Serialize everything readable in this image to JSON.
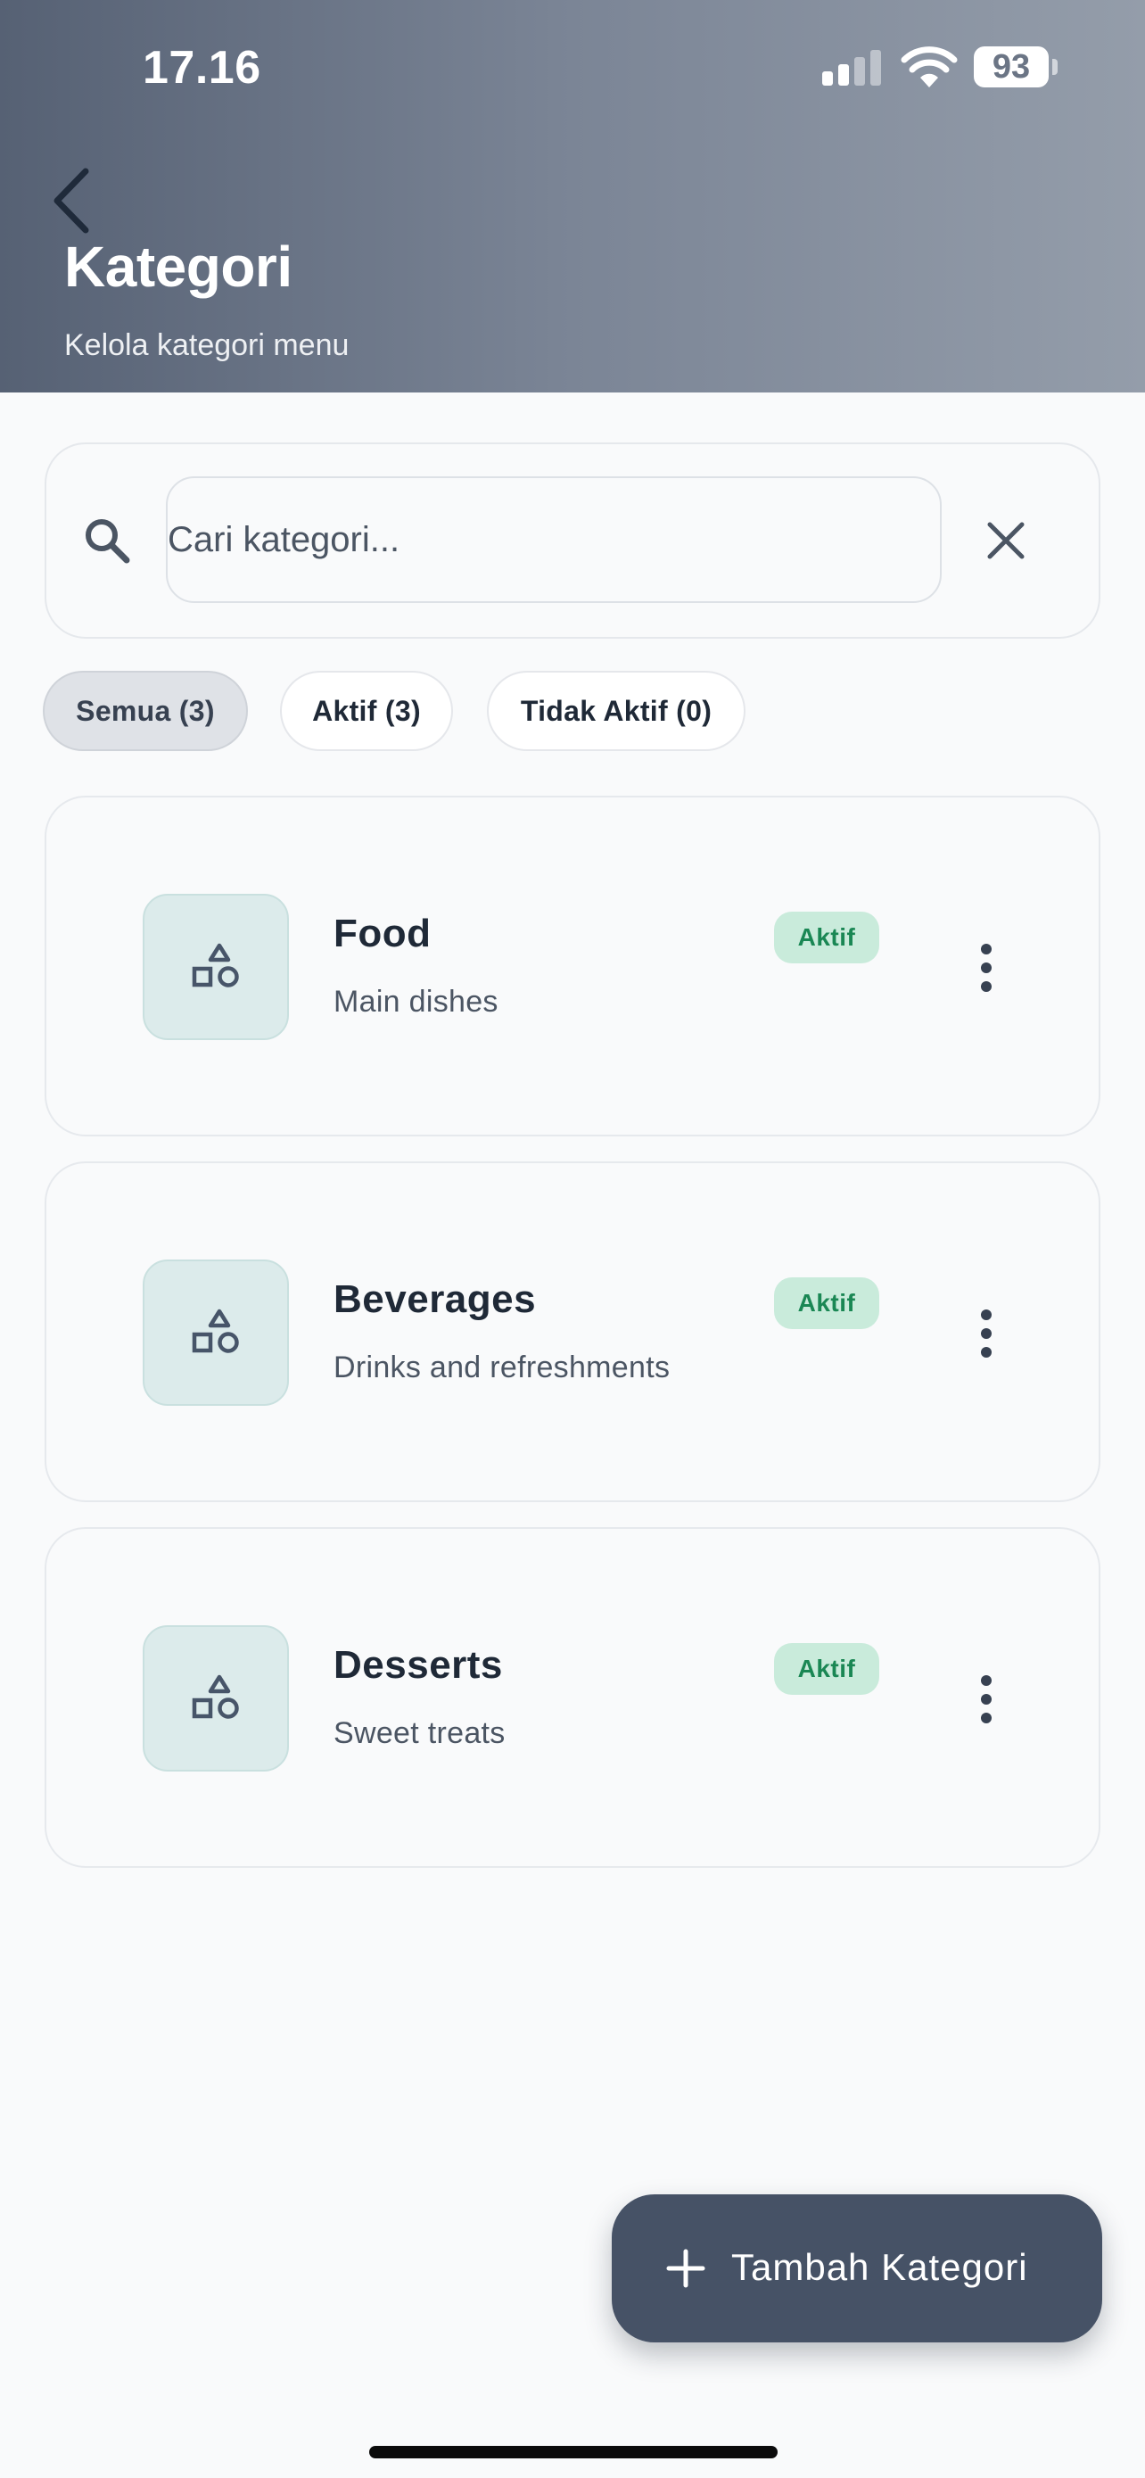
{
  "status_bar": {
    "time": "17.16",
    "battery": "93"
  },
  "header": {
    "title": "Kategori",
    "subtitle": "Kelola kategori menu"
  },
  "search": {
    "placeholder": "Cari kategori...",
    "value": ""
  },
  "filters": [
    {
      "label": "Semua (3)",
      "active": true
    },
    {
      "label": "Aktif (3)",
      "active": false
    },
    {
      "label": "Tidak Aktif (0)",
      "active": false
    }
  ],
  "categories": [
    {
      "name": "Food",
      "description": "Main dishes",
      "status": "Aktif",
      "icon": "shapes-icon"
    },
    {
      "name": "Beverages",
      "description": "Drinks and refreshments",
      "status": "Aktif",
      "icon": "shapes-icon"
    },
    {
      "name": "Desserts",
      "description": "Sweet treats",
      "status": "Aktif",
      "icon": "shapes-icon"
    }
  ],
  "fab": {
    "label": "Tambah Kategori",
    "icon": "plus-icon"
  },
  "colors": {
    "header_gradient_start": "#566174",
    "header_gradient_end": "#949daa",
    "badge_bg": "#c9ebdb",
    "badge_text": "#1a8754",
    "fab_bg": "#465266",
    "icon_tile_bg": "#dcebeb"
  }
}
